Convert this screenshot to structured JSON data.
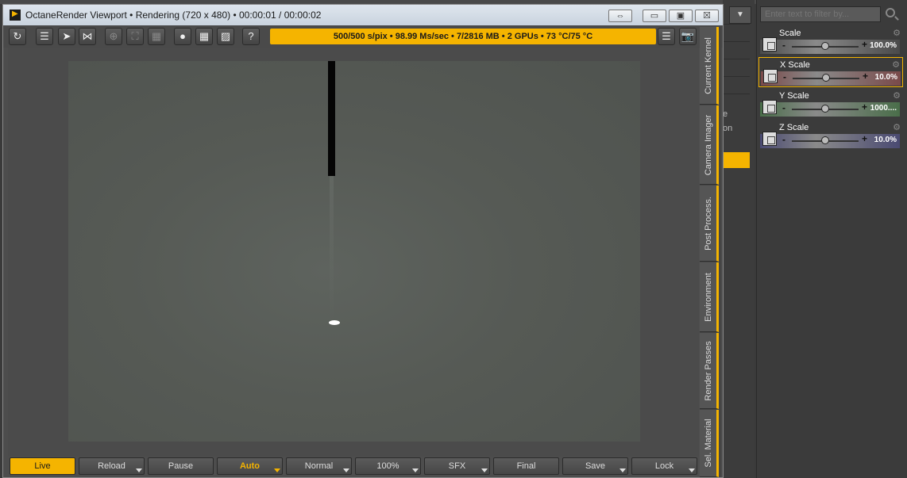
{
  "window": {
    "title": "OctaneRender Viewport • Rendering (720 x 480) • 00:00:01 / 00:00:02",
    "btn_restore": "⇔",
    "btn_minimize": "▭",
    "btn_maximize": "▣",
    "btn_close": "☒"
  },
  "toolbar": {
    "icons": {
      "reset": "↻",
      "scene": "☰",
      "export": "➤",
      "share": "⋈",
      "target": "⊕",
      "fit": "⛶",
      "grid4": "▦",
      "record": "●",
      "grid": "▦",
      "picture": "▨",
      "help": "?",
      "list": "☰",
      "camera": "📷"
    },
    "status": "500/500 s/pix • 98.99 Ms/sec • 7/2816 MB • 2 GPUs • 73 °C/75 °C"
  },
  "side_tabs": [
    "Current Kernel",
    "Camera Imager",
    "Post Process.",
    "Environment",
    "Render Passes",
    "Sel. Material"
  ],
  "bottom_bar": {
    "live": "Live",
    "reload": "Reload",
    "pause": "Pause",
    "auto": "Auto",
    "normal": "Normal",
    "zoom": "100%",
    "sfx": "SFX",
    "final": "Final",
    "save": "Save",
    "lock": "Lock"
  },
  "host": {
    "dropdown": "▼",
    "frag_1": "e",
    "frag_2": "on"
  },
  "panel": {
    "filter_placeholder": "Enter text to filter by...",
    "params": [
      {
        "label": "Scale",
        "minus": "-",
        "plus": "+",
        "value": "100.0%",
        "gear": "⚙",
        "slider_position": 0.5,
        "tint": "#4a4a4a"
      },
      {
        "label": "X Scale",
        "minus": "-",
        "plus": "+",
        "value": "10.0%",
        "gear": "⚙",
        "slider_position": 0.5,
        "tint": "#7a4a4a"
      },
      {
        "label": "Y Scale",
        "minus": "-",
        "plus": "+",
        "value": "1000....",
        "gear": "⚙",
        "slider_position": 0.5,
        "tint": "#4a6e4a"
      },
      {
        "label": "Z Scale",
        "minus": "-",
        "plus": "+",
        "value": "10.0%",
        "gear": "⚙",
        "slider_position": 0.5,
        "tint": "#4a4a72"
      }
    ]
  },
  "colors": {
    "accent": "#f5b400",
    "background": "#3a3a3a"
  }
}
